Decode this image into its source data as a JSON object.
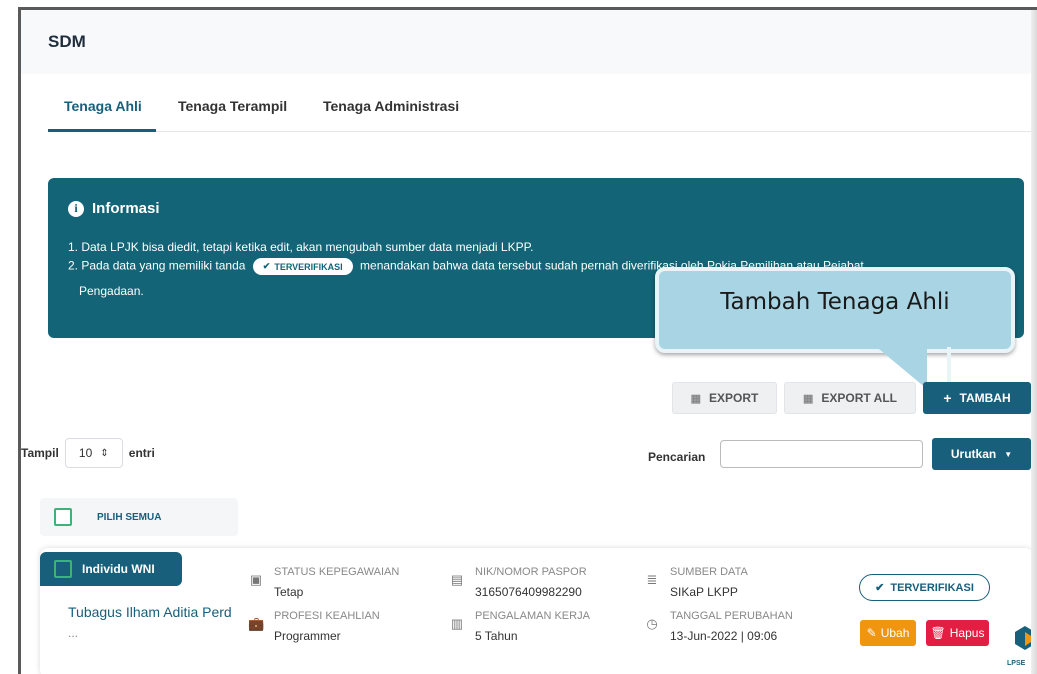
{
  "header": {
    "title": "SDM"
  },
  "tabs": [
    {
      "label": "Tenaga Ahli",
      "active": true
    },
    {
      "label": "Tenaga Terampil",
      "active": false
    },
    {
      "label": "Tenaga Administrasi",
      "active": false
    }
  ],
  "info": {
    "title": "Informasi",
    "line1": "1. Data LPJK bisa diedit, tetapi ketika edit, akan mengubah sumber data menjadi LKPP.",
    "line2_prefix": "2. Pada data yang memiliki tanda",
    "line2_badge": "TERVERIFIKASI",
    "line2_suffix": "menandakan bahwa data tersebut sudah pe",
    "line2_hidden_tail": "rnah diverifikasi oleh Pokja Pemilihan atau Pejabat",
    "line3": "Pengadaan."
  },
  "callout": {
    "text": "Tambah Tenaga Ahli"
  },
  "toolbar": {
    "export_label": "EXPORT",
    "export_all_label": "EXPORT ALL",
    "add_label": "TAMBAH"
  },
  "list_controls": {
    "show_prefix": "Tampil",
    "page_size": "10",
    "show_suffix": "entri",
    "search_label": "Pencarian",
    "search_value": "",
    "sort_label": "Urutkan"
  },
  "select_all_label": "PILIH SEMUA",
  "records": [
    {
      "type": "Individu WNI",
      "name": "Tubagus Ilham Aditia Perd",
      "name_more": "...",
      "status_label": "STATUS KEPEGAWAIAN",
      "status_value": "Tetap",
      "profesi_label": "PROFESI KEAHLIAN",
      "profesi_value": "Programmer",
      "nik_label": "NIK/NOMOR PASPOR",
      "nik_value": "3165076409982290",
      "pengalaman_label": "PENGALAMAN KERJA",
      "pengalaman_value": "5 Tahun",
      "sumber_label": "SUMBER DATA",
      "sumber_value": "SIKaP LKPP",
      "tanggal_label": "TANGGAL PERUBAHAN",
      "tanggal_value": "13-Jun-2022 | 09:06",
      "verified_label": "TERVERIFIKASI",
      "edit_label": "Ubah",
      "delete_label": "Hapus"
    }
  ],
  "footer": {
    "logo_text": "LPSE"
  },
  "colors": {
    "primary": "#175f7a",
    "info_bg": "#136476",
    "callout_bg": "#a8d4e3",
    "edit": "#f0950f",
    "delete": "#e31e42",
    "checkbox": "#3db37a"
  }
}
